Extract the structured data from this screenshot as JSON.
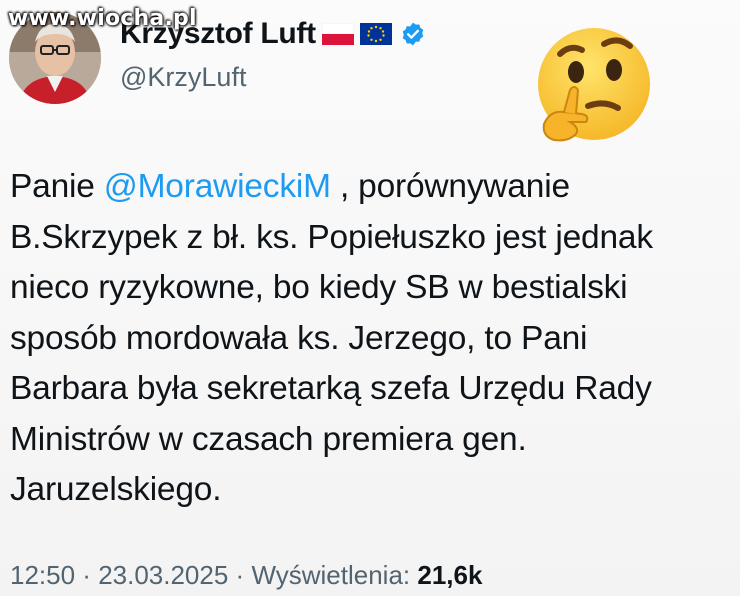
{
  "watermark": "www.wiocha.pl",
  "author": {
    "display_name": "Krzysztof Luft",
    "handle": "@KrzyLuft",
    "flags": [
      "poland-flag-icon",
      "eu-flag-icon"
    ],
    "badge": "verified-badge-icon"
  },
  "reaction_emoji": "thinking-face-icon",
  "tweet": {
    "text_before": "Panie ",
    "mention": "@MorawieckiM",
    "text_after": " , porównywanie\nB.Skrzypek z bł. ks. Popiełuszko jest jednak\nnieco ryzykowne, bo kiedy SB w bestialski\nsposób mordowała ks. Jerzego, to Pani\nBarbara była sekretarką szefa Urzędu Rady\nMinistrów w czasach premiera gen.\nJaruzelskiego."
  },
  "meta": {
    "time": "12:50",
    "sep1": " · ",
    "date": "23.03.2025",
    "sep2": " · ",
    "views_label": "Wyświetlenia: ",
    "views_count": "21,6k"
  },
  "colors": {
    "mention": "#1d9bf0",
    "secondary_text": "#536471",
    "verified": "#1d9bf0"
  }
}
